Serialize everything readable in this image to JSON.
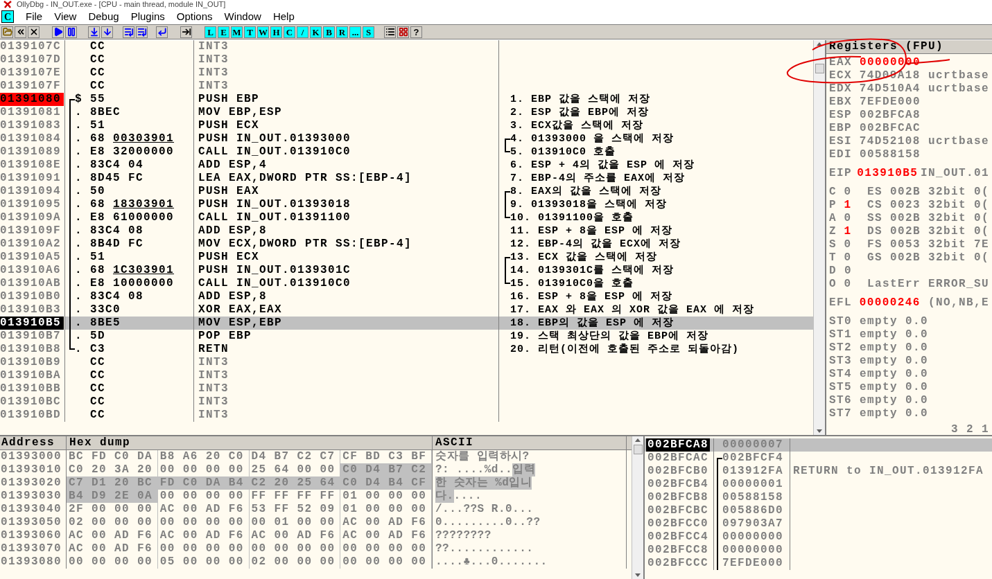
{
  "window": {
    "title": "OllyDbg - IN_OUT.exe - [CPU - main thread, module IN_OUT]"
  },
  "menu": {
    "badge": "C",
    "items": [
      "File",
      "View",
      "Debug",
      "Plugins",
      "Options",
      "Window",
      "Help"
    ]
  },
  "toolbar": {
    "letters": [
      "L",
      "E",
      "M",
      "T",
      "W",
      "H",
      "C",
      "/",
      "K",
      "B",
      "R",
      "...",
      "S"
    ],
    "help": "?"
  },
  "disasm": [
    {
      "address": "0139107C",
      "hex": "CC",
      "asm": "INT3",
      "kind": "filler",
      "entry": false,
      "current": false,
      "selected": false,
      "in_bracket": false
    },
    {
      "address": "0139107D",
      "hex": "CC",
      "asm": "INT3",
      "kind": "filler",
      "entry": false,
      "current": false,
      "selected": false,
      "in_bracket": false
    },
    {
      "address": "0139107E",
      "hex": "CC",
      "asm": "INT3",
      "kind": "filler",
      "entry": false,
      "current": false,
      "selected": false,
      "in_bracket": false
    },
    {
      "address": "0139107F",
      "hex": "CC",
      "asm": "INT3",
      "kind": "filler",
      "entry": false,
      "current": false,
      "selected": false,
      "in_bracket": false
    },
    {
      "address": "01391080",
      "marker": "$",
      "hex": "55",
      "asm": "PUSH EBP",
      "kind": "code",
      "entry": true,
      "current": false,
      "selected": false,
      "in_bracket": true,
      "bracket_top": true,
      "comment": "1. EBP 값을 스택에 저장"
    },
    {
      "address": "01391081",
      "marker": ".",
      "hex": "8BEC",
      "asm": "MOV EBP,ESP",
      "kind": "code",
      "entry": false,
      "current": false,
      "selected": false,
      "in_bracket": true,
      "comment": "2. ESP 값을 EBP에 저장"
    },
    {
      "address": "01391083",
      "marker": ".",
      "hex": "51",
      "asm": "PUSH ECX",
      "kind": "code",
      "entry": false,
      "current": false,
      "selected": false,
      "in_bracket": true,
      "comment": "3. ECX값을 스택에 저장"
    },
    {
      "address": "01391084",
      "marker": ".",
      "hex": "68",
      "hex_ref": "00303901",
      "asm": "PUSH IN_OUT.01393000",
      "kind": "code",
      "entry": false,
      "current": false,
      "selected": false,
      "in_bracket": true,
      "comment": "4. 01393000 을 스택에 저장",
      "note_bracket": true,
      "note_bracket_top": true
    },
    {
      "address": "01391089",
      "marker": ".",
      "hex": "E8 32000000",
      "asm": "CALL IN_OUT.013910C0",
      "kind": "code",
      "entry": false,
      "current": false,
      "selected": false,
      "in_bracket": true,
      "comment": "5. 013910C0 호출",
      "note_bracket": true,
      "note_bracket_bottom": true
    },
    {
      "address": "0139108E",
      "marker": ".",
      "hex": "83C4 04",
      "asm": "ADD ESP,4",
      "kind": "code",
      "entry": false,
      "current": false,
      "selected": false,
      "in_bracket": true,
      "comment": "6. ESP + 4의 값을 ESP 에 저장"
    },
    {
      "address": "01391091",
      "marker": ".",
      "hex": "8D45 FC",
      "asm": "LEA EAX,DWORD PTR SS:[EBP-4]",
      "kind": "code",
      "entry": false,
      "current": false,
      "selected": false,
      "in_bracket": true,
      "comment": "7. EBP-4의 주소를 EAX에 저장"
    },
    {
      "address": "01391094",
      "marker": ".",
      "hex": "50",
      "asm": "PUSH EAX",
      "kind": "code",
      "entry": false,
      "current": false,
      "selected": false,
      "in_bracket": true,
      "comment": "8. EAX의 값을 스택에 저장",
      "note_bracket": true,
      "note_bracket_top": true
    },
    {
      "address": "01391095",
      "marker": ".",
      "hex": "68",
      "hex_ref": "18303901",
      "asm": "PUSH IN_OUT.01393018",
      "kind": "code",
      "entry": false,
      "current": false,
      "selected": false,
      "in_bracket": true,
      "comment": "9. 01393018을 스택에 저장",
      "note_bracket": true
    },
    {
      "address": "0139109A",
      "marker": ".",
      "hex": "E8 61000000",
      "asm": "CALL IN_OUT.01391100",
      "kind": "code",
      "entry": false,
      "current": false,
      "selected": false,
      "in_bracket": true,
      "comment": "10. 01391100을 호출",
      "note_bracket": true,
      "note_bracket_bottom": true
    },
    {
      "address": "0139109F",
      "marker": ".",
      "hex": "83C4 08",
      "asm": "ADD ESP,8",
      "kind": "code",
      "entry": false,
      "current": false,
      "selected": false,
      "in_bracket": true,
      "comment": "11. ESP + 8을 ESP 에 저장"
    },
    {
      "address": "013910A2",
      "marker": ".",
      "hex": "8B4D FC",
      "asm": "MOV ECX,DWORD PTR SS:[EBP-4]",
      "kind": "code",
      "entry": false,
      "current": false,
      "selected": false,
      "in_bracket": true,
      "comment": "12. EBP-4의 값을 ECX에 저장"
    },
    {
      "address": "013910A5",
      "marker": ".",
      "hex": "51",
      "asm": "PUSH ECX",
      "kind": "code",
      "entry": false,
      "current": false,
      "selected": false,
      "in_bracket": true,
      "comment": "13. ECX 값을 스택에 저장",
      "note_bracket": true,
      "note_bracket_top": true
    },
    {
      "address": "013910A6",
      "marker": ".",
      "hex": "68",
      "hex_ref": "1C303901",
      "asm": "PUSH IN_OUT.0139301C",
      "kind": "code",
      "entry": false,
      "current": false,
      "selected": false,
      "in_bracket": true,
      "comment": "14. 0139301C를 스택에 저장",
      "note_bracket": true
    },
    {
      "address": "013910AB",
      "marker": ".",
      "hex": "E8 10000000",
      "asm": "CALL IN_OUT.013910C0",
      "kind": "code",
      "entry": false,
      "current": false,
      "selected": false,
      "in_bracket": true,
      "comment": "15. 013910C0을 호출",
      "note_bracket": true,
      "note_bracket_bottom": true
    },
    {
      "address": "013910B0",
      "marker": ".",
      "hex": "83C4 08",
      "asm": "ADD ESP,8",
      "kind": "code",
      "entry": false,
      "current": false,
      "selected": false,
      "in_bracket": true,
      "comment": "16. ESP + 8을 ESP 에 저장"
    },
    {
      "address": "013910B3",
      "marker": ".",
      "hex": "33C0",
      "asm": "XOR EAX,EAX",
      "kind": "code",
      "entry": false,
      "current": false,
      "selected": false,
      "in_bracket": true,
      "comment": "17. EAX 와 EAX 의 XOR 값을 EAX 에 저장"
    },
    {
      "address": "013910B5",
      "marker": ".",
      "hex": "8BE5",
      "asm": "MOV ESP,EBP",
      "kind": "code",
      "entry": false,
      "current": true,
      "selected": true,
      "in_bracket": true,
      "comment": "18. EBP의 값을 ESP 에 저장"
    },
    {
      "address": "013910B7",
      "marker": ".",
      "hex": "5D",
      "asm": "POP EBP",
      "kind": "code",
      "entry": false,
      "current": false,
      "selected": false,
      "in_bracket": true,
      "comment": "19. 스택 최상단의 값을 EBP에 저장"
    },
    {
      "address": "013910B8",
      "marker": ".",
      "hex": "C3",
      "asm": "RETN",
      "kind": "code",
      "entry": false,
      "current": false,
      "selected": false,
      "in_bracket": true,
      "bracket_bottom": true,
      "comment": "20. 리턴(이전에 호출된 주소로 되돌아감)"
    },
    {
      "address": "013910B9",
      "hex": "CC",
      "asm": "INT3",
      "kind": "filler",
      "entry": false,
      "current": false,
      "selected": false,
      "in_bracket": false
    },
    {
      "address": "013910BA",
      "hex": "CC",
      "asm": "INT3",
      "kind": "filler",
      "entry": false,
      "current": false,
      "selected": false,
      "in_bracket": false
    },
    {
      "address": "013910BB",
      "hex": "CC",
      "asm": "INT3",
      "kind": "filler",
      "entry": false,
      "current": false,
      "selected": false,
      "in_bracket": false
    },
    {
      "address": "013910BC",
      "hex": "CC",
      "asm": "INT3",
      "kind": "filler",
      "entry": false,
      "current": false,
      "selected": false,
      "in_bracket": false
    },
    {
      "address": "013910BD",
      "hex": "CC",
      "asm": "INT3",
      "kind": "filler",
      "entry": false,
      "current": false,
      "selected": false,
      "in_bracket": false
    }
  ],
  "registers": {
    "title": "Registers (FPU)",
    "lines": [
      {
        "kind": "reg",
        "name": "EAX",
        "value": "00000000",
        "changed": true
      },
      {
        "kind": "reg",
        "name": "ECX",
        "value": "74D09A18",
        "changed": false,
        "note": "ucrtbase"
      },
      {
        "kind": "reg",
        "name": "EDX",
        "value": "74D510A4",
        "changed": false,
        "note": "ucrtbase"
      },
      {
        "kind": "reg",
        "name": "EBX",
        "value": "7EFDE000",
        "changed": false
      },
      {
        "kind": "reg",
        "name": "ESP",
        "value": "002BFCA8",
        "changed": false
      },
      {
        "kind": "reg",
        "name": "EBP",
        "value": "002BFCAC",
        "changed": false
      },
      {
        "kind": "reg",
        "name": "ESI",
        "value": "74D52108",
        "changed": false,
        "note": "ucrtbase"
      },
      {
        "kind": "reg",
        "name": "EDI",
        "value": "00588158",
        "changed": false
      },
      {
        "kind": "reg",
        "name": "EIP",
        "value": "013910B5",
        "changed": true,
        "note": "IN_OUT.01",
        "gap_before": true
      },
      {
        "kind": "flag",
        "name": "C",
        "value": "0",
        "changed": false,
        "note": "ES 002B 32bit 0(",
        "gap_before": true
      },
      {
        "kind": "flag",
        "name": "P",
        "value": "1",
        "changed": true,
        "note": "CS 0023 32bit 0("
      },
      {
        "kind": "flag",
        "name": "A",
        "value": "0",
        "changed": false,
        "note": "SS 002B 32bit 0("
      },
      {
        "kind": "flag",
        "name": "Z",
        "value": "1",
        "changed": true,
        "note": "DS 002B 32bit 0("
      },
      {
        "kind": "flag",
        "name": "S",
        "value": "0",
        "changed": false,
        "note": "FS 0053 32bit 7E"
      },
      {
        "kind": "flag",
        "name": "T",
        "value": "0",
        "changed": false,
        "note": "GS 002B 32bit 0("
      },
      {
        "kind": "flag",
        "name": "D",
        "value": "0",
        "changed": false
      },
      {
        "kind": "flag",
        "name": "O",
        "value": "0",
        "changed": false,
        "note": "LastErr ERROR_SU"
      },
      {
        "kind": "reg",
        "name": "EFL",
        "value": "00000246",
        "changed": true,
        "note": "(NO,NB,E",
        "gap_before": true
      },
      {
        "kind": "fpu",
        "name": "ST0",
        "value": "empty 0.0",
        "changed": false,
        "gap_before": true
      },
      {
        "kind": "fpu",
        "name": "ST1",
        "value": "empty 0.0",
        "changed": false
      },
      {
        "kind": "fpu",
        "name": "ST2",
        "value": "empty 0.0",
        "changed": false
      },
      {
        "kind": "fpu",
        "name": "ST3",
        "value": "empty 0.0",
        "changed": false
      },
      {
        "kind": "fpu",
        "name": "ST4",
        "value": "empty 0.0",
        "changed": false
      },
      {
        "kind": "fpu",
        "name": "ST5",
        "value": "empty 0.0",
        "changed": false
      },
      {
        "kind": "fpu",
        "name": "ST6",
        "value": "empty 0.0",
        "changed": false
      },
      {
        "kind": "fpu",
        "name": "ST7",
        "value": "empty 0.0",
        "changed": false
      },
      {
        "kind": "footer",
        "value": "3 2 1"
      }
    ]
  },
  "dump": {
    "columns": [
      "Address",
      "Hex dump",
      "ASCII"
    ],
    "rows": [
      {
        "address": "01393000",
        "groups": [
          {
            "text": "BC FD C0 DA",
            "selected": false
          },
          {
            "text": "B8 A6 20 C0",
            "selected": false
          },
          {
            "text": "D4 B7 C2 C7",
            "selected": false
          },
          {
            "text": "CF BD C3 BF",
            "selected": false
          }
        ],
        "ascii": [
          {
            "text": "숫자를 입력하시?",
            "selected": false
          }
        ]
      },
      {
        "address": "01393010",
        "groups": [
          {
            "text": "C0 20 3A 20",
            "selected": false
          },
          {
            "text": "00 00 00 00",
            "selected": false
          },
          {
            "text": "25 64 00 00",
            "selected": false
          },
          {
            "text": "C0 D4 B7 C2",
            "selected": true
          }
        ],
        "ascii": [
          {
            "text": "?: ....%d..",
            "selected": false
          },
          {
            "text": "입력",
            "selected": true
          }
        ]
      },
      {
        "address": "01393020",
        "groups": [
          {
            "text": "C7 D1 20 BC",
            "selected": true
          },
          {
            "text": "FD C0 DA B4",
            "selected": true
          },
          {
            "text": "C2 20 25 64",
            "selected": true
          },
          {
            "text": "C0 D4 B4 CF",
            "selected": true
          }
        ],
        "ascii": [
          {
            "text": "한 숫자는 %d입니",
            "selected": true
          }
        ]
      },
      {
        "address": "01393030",
        "groups": [
          {
            "text": "B4 D9 2E 0A",
            "selected": true
          },
          {
            "text": "00 00 00 00",
            "selected": false
          },
          {
            "text": "FF FF FF FF",
            "selected": false
          },
          {
            "text": "01 00 00 00",
            "selected": false
          }
        ],
        "ascii": [
          {
            "text": "다.",
            "selected": true
          },
          {
            "text": "....",
            "selected": false
          }
        ]
      },
      {
        "address": "01393040",
        "groups": [
          {
            "text": "2F 00 00 00",
            "selected": false
          },
          {
            "text": "AC 00 AD F6",
            "selected": false
          },
          {
            "text": "53 FF 52 09",
            "selected": false
          },
          {
            "text": "01 00 00 00",
            "selected": false
          }
        ],
        "ascii": [
          {
            "text": "/...??S  R.0...",
            "selected": false
          }
        ]
      },
      {
        "address": "01393050",
        "groups": [
          {
            "text": "02 00 00 00",
            "selected": false
          },
          {
            "text": "00 00 00 00",
            "selected": false
          },
          {
            "text": "00 01 00 00",
            "selected": false
          },
          {
            "text": "AC 00 AD F6",
            "selected": false
          }
        ],
        "ascii": [
          {
            "text": "0.........0..??",
            "selected": false
          }
        ]
      },
      {
        "address": "01393060",
        "groups": [
          {
            "text": "AC 00 AD F6",
            "selected": false
          },
          {
            "text": "AC 00 AD F6",
            "selected": false
          },
          {
            "text": "AC 00 AD F6",
            "selected": false
          },
          {
            "text": "AC 00 AD F6",
            "selected": false
          }
        ],
        "ascii": [
          {
            "text": "????????",
            "selected": false
          }
        ]
      },
      {
        "address": "01393070",
        "groups": [
          {
            "text": "AC 00 AD F6",
            "selected": false
          },
          {
            "text": "00 00 00 00",
            "selected": false
          },
          {
            "text": "00 00 00 00",
            "selected": false
          },
          {
            "text": "00 00 00 00",
            "selected": false
          }
        ],
        "ascii": [
          {
            "text": "??............",
            "selected": false
          }
        ]
      },
      {
        "address": "01393080",
        "groups": [
          {
            "text": "00 00 00 00",
            "selected": false
          },
          {
            "text": "05 00 00 00",
            "selected": false
          },
          {
            "text": "02 00 00 00",
            "selected": false
          },
          {
            "text": "00 00 00 00",
            "selected": false
          }
        ],
        "ascii": [
          {
            "text": "....♣...0.......",
            "selected": false
          }
        ]
      }
    ]
  },
  "stack": [
    {
      "address": "002BFCA8",
      "value": "00000007",
      "selected": true,
      "in_bracket": false
    },
    {
      "address": "002BFCAC",
      "value": "002BFCF4",
      "selected": false,
      "in_bracket": true,
      "bracket_top": true
    },
    {
      "address": "002BFCB0",
      "value": "013912FA",
      "selected": false,
      "in_bracket": true,
      "comment": "RETURN to IN_OUT.013912FA"
    },
    {
      "address": "002BFCB4",
      "value": "00000001",
      "selected": false,
      "in_bracket": true
    },
    {
      "address": "002BFCB8",
      "value": "00588158",
      "selected": false,
      "in_bracket": true
    },
    {
      "address": "002BFCBC",
      "value": "005886D0",
      "selected": false,
      "in_bracket": true
    },
    {
      "address": "002BFCC0",
      "value": "097903A7",
      "selected": false,
      "in_bracket": true
    },
    {
      "address": "002BFCC4",
      "value": "00000000",
      "selected": false,
      "in_bracket": true
    },
    {
      "address": "002BFCC8",
      "value": "00000000",
      "selected": false,
      "in_bracket": true
    },
    {
      "address": "002BFCCC",
      "value": "7EFDE000",
      "selected": false,
      "in_bracket": true
    }
  ]
}
